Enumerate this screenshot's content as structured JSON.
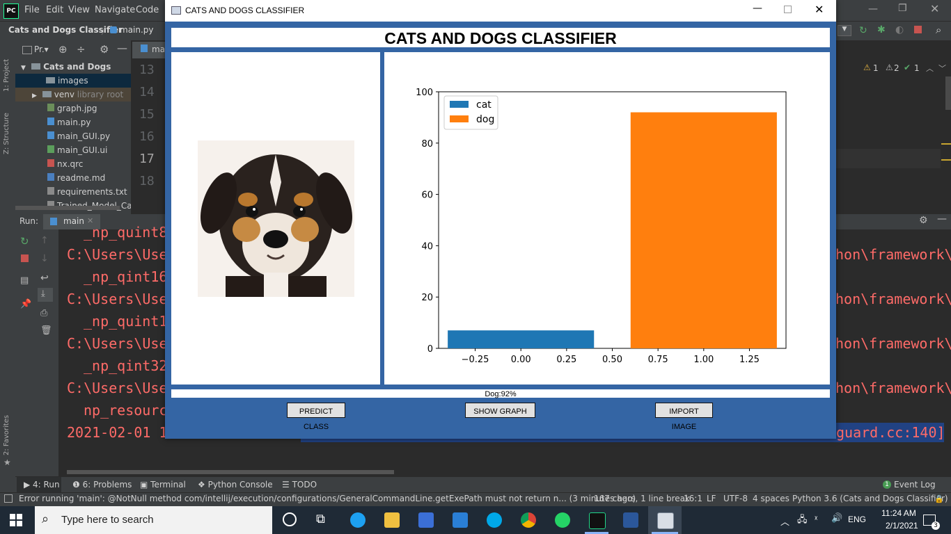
{
  "ide": {
    "menu": [
      "File",
      "Edit",
      "View",
      "Navigate",
      "Code"
    ],
    "breadcrumb": [
      "Cats and Dogs Classifier",
      "main.py"
    ],
    "project_toolbar_label": "Pr.▾",
    "editor_tab_partial": "ma",
    "tree": [
      {
        "label": "Cats and Dogs Classifie",
        "kind": "folder"
      },
      {
        "label": "images",
        "kind": "folder"
      },
      {
        "label": "venv",
        "kind": "folder",
        "note": "library root"
      },
      {
        "label": "graph.jpg",
        "kind": "file"
      },
      {
        "label": "main.py",
        "kind": "file"
      },
      {
        "label": "main_GUI.py",
        "kind": "file"
      },
      {
        "label": "main_GUI.ui",
        "kind": "file"
      },
      {
        "label": "nx.qrc",
        "kind": "file"
      },
      {
        "label": "readme.md",
        "kind": "file"
      },
      {
        "label": "requirements.txt",
        "kind": "file"
      },
      {
        "label": "Trained_Model_Cat&",
        "kind": "file"
      }
    ],
    "line_numbers": [
      "13",
      "14",
      "15",
      "16",
      "17",
      "18"
    ],
    "inspection": {
      "warnings": "1",
      "weak": "2",
      "ok": "1"
    },
    "side_tabs": {
      "project": "1: Project",
      "structure": "Z: Structure",
      "favorites": "2: Favorites"
    },
    "run": {
      "label": "Run:",
      "config": "main",
      "console_left": [
        "_np_quint8",
        "C:\\Users\\Use",
        "_np_qint16",
        "C:\\Users\\Use",
        "_np_quint1",
        "C:\\Users\\Use",
        "_np_qint32",
        "C:\\Users\\Use",
        "np_resourc",
        "2021-02-01 1"
      ],
      "console_right": [
        "hon\\framework\\",
        "hon\\framework\\",
        "hon\\framework\\",
        "hon\\framework\\"
      ],
      "console_tail": "guard.cc:140]"
    },
    "bottom_tabs": [
      "4: Run",
      "6: Problems",
      "Terminal",
      "Python Console",
      "TODO"
    ],
    "event_log": "Event Log",
    "event_log_count": "1",
    "status": {
      "message": "Error running 'main': @NotNull method com/intellij/execution/configurations/GeneralCommandLine.getExePath must not return n... (3 minutes ago)",
      "chars": "167 chars, 1 line break",
      "position": "16:1",
      "line_sep": "LF",
      "encoding": "UTF-8",
      "indent": "4 spaces",
      "interpreter": "Python 3.6 (Cats and Dogs Classifier)"
    }
  },
  "app": {
    "window_title": "CATS AND DOGS CLASSIFIER",
    "header": "CATS AND DOGS CLASSIFIER",
    "result": "Dog:92%",
    "buttons": {
      "predict": "PREDICT CLASS",
      "graph": "SHOW GRAPH",
      "import": "IMPORT IMAGE"
    }
  },
  "chart_data": {
    "type": "bar",
    "series": [
      {
        "name": "cat",
        "x": 0.0,
        "value": 7,
        "color": "#1f77b4"
      },
      {
        "name": "dog",
        "x": 1.0,
        "value": 92,
        "color": "#ff7f0e"
      }
    ],
    "bar_width": 0.8,
    "xlim": [
      -0.45,
      1.45
    ],
    "ylim": [
      0,
      100
    ],
    "xticks": [
      "−0.25",
      "0.00",
      "0.25",
      "0.50",
      "0.75",
      "1.00",
      "1.25"
    ],
    "xtick_values": [
      -0.25,
      0,
      0.25,
      0.5,
      0.75,
      1.0,
      1.25
    ],
    "yticks": [
      "0",
      "20",
      "40",
      "60",
      "80",
      "100"
    ],
    "ytick_values": [
      0,
      20,
      40,
      60,
      80,
      100
    ],
    "legend_position": "upper left",
    "grid": false
  },
  "taskbar": {
    "search_placeholder": "Type here to search",
    "time": "11:24 AM",
    "date": "2/1/2021",
    "language": "ENG",
    "notification_count": "3"
  }
}
